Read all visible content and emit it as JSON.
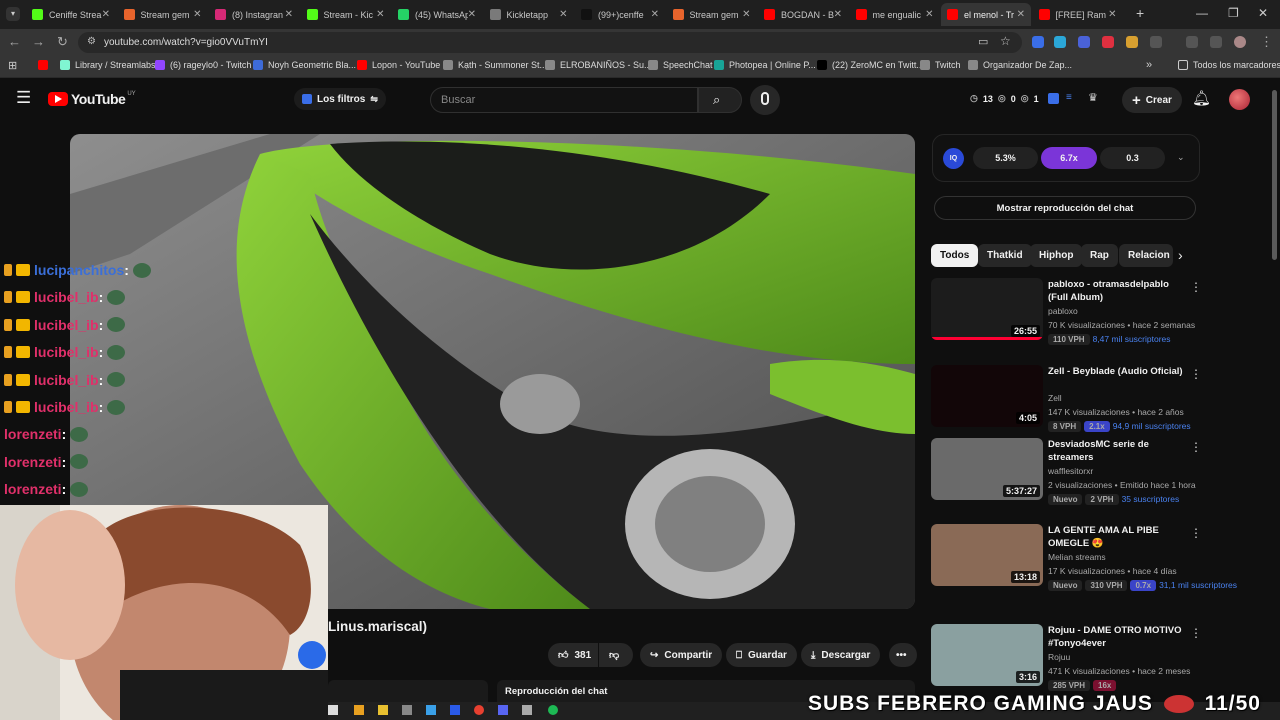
{
  "browser": {
    "tabs": [
      {
        "label": "Ceniffe Strea",
        "color": "#53fc18"
      },
      {
        "label": "Stream gem",
        "color": "#e8642c"
      },
      {
        "label": "(8) Instagran",
        "color": "#d62976"
      },
      {
        "label": "Stream - Kic",
        "color": "#53fc18"
      },
      {
        "label": "(45) WhatsAp",
        "color": "#25d366"
      },
      {
        "label": "Kickletapp",
        "color": "#7a7a7a"
      },
      {
        "label": "(99+)cenffe",
        "color": "#111111"
      },
      {
        "label": "Stream gem",
        "color": "#e8642c"
      },
      {
        "label": "BOGDAN - B",
        "color": "#ff0000"
      },
      {
        "label": "me engualic",
        "color": "#ff0000"
      },
      {
        "label": "el menol - Tr",
        "color": "#ff0000"
      },
      {
        "label": "[FREE] Ram",
        "color": "#ff0000"
      }
    ],
    "url": "youtube.com/watch?v=gio0VVuTmYI",
    "bookmarks": [
      {
        "label": "",
        "color": "#ff0000"
      },
      {
        "label": "Library / Streamlabs",
        "color": "#80f5d2"
      },
      {
        "label": "(6) rageylo0 - Twitch",
        "color": "#9146ff"
      },
      {
        "label": "Noyh Geometric Bla...",
        "color": "#3d6bd8"
      },
      {
        "label": "Lopon - YouTube",
        "color": "#ff0000"
      },
      {
        "label": "Kạth - Summoner St...",
        "color": "#888888"
      },
      {
        "label": "ELROBANIÑOS - Su...",
        "color": "#888888"
      },
      {
        "label": "SpeechChat",
        "color": "#888888"
      },
      {
        "label": "Photopea | Online P...",
        "color": "#18a497"
      },
      {
        "label": "(22) ZeroMC en Twitt...",
        "color": "#000000"
      },
      {
        "label": "Twitch",
        "color": "#888888"
      },
      {
        "label": "Organizador De Zap...",
        "color": "#888888"
      }
    ],
    "all_bookmarks": "Todos los marcadores"
  },
  "youtube": {
    "logo": "YouTube",
    "country": "UY",
    "filter_label": "Los filtros",
    "search_placeholder": "Buscar",
    "header_stats": {
      "a": "13",
      "b": "0",
      "c": "1"
    },
    "create_label": "Crear",
    "ext_stats": {
      "p1": "5.3%",
      "p2": "6.7x",
      "p3": "0.3"
    },
    "show_chat": "Mostrar reproducción del chat",
    "chips": [
      "Todos",
      "Thatkid",
      "Hiphop",
      "Rap",
      "Relacion"
    ],
    "video_title_fragment": "Linus.mariscal)",
    "likes": "381",
    "share": "Compartir",
    "save": "Guardar",
    "download": "Descargar",
    "chat_replay": "Reproducción del chat"
  },
  "chat_overlay": [
    {
      "user": "lucipanchitos",
      "color": "#3b6fd8"
    },
    {
      "user": "lucibel_ib",
      "color": "#e0306a"
    },
    {
      "user": "lucibel_ib",
      "color": "#e0306a"
    },
    {
      "user": "lucibel_ib",
      "color": "#e0306a"
    },
    {
      "user": "lucibel_ib",
      "color": "#e0306a"
    },
    {
      "user": "lucibel_ib",
      "color": "#e0306a"
    },
    {
      "user": "lorenzeti",
      "color": "#e0306a"
    },
    {
      "user": "lorenzeti",
      "color": "#e0306a"
    },
    {
      "user": "lorenzeti",
      "color": "#e0306a"
    }
  ],
  "recommendations": [
    {
      "title": "pabloxo - otramasdelpablo (Full Album)",
      "channel": "pabloxo",
      "meta": "70 K visualizaciones • hace 2 semanas",
      "duration": "26:55",
      "tags": [
        "110 VPH"
      ],
      "subs": "8,47 mil suscriptores",
      "thumb": "#1c1c1c"
    },
    {
      "title": "Zell - Beyblade (Audio Oficial)",
      "channel": "Zell",
      "meta": "147 K visualizaciones • hace 2 años",
      "duration": "4:05",
      "tags": [
        "8 VPH",
        "2.1x"
      ],
      "subs": "94,9 mil suscriptores",
      "thumb": "#120608"
    },
    {
      "title": "DesviadosMC serie de streamers",
      "channel": "wafflesitorxr",
      "meta": "2 visualizaciones • Emitido hace 1 hora",
      "duration": "5:37:27",
      "tags": [
        "Nuevo",
        "2 VPH"
      ],
      "subs": "35 suscriptores",
      "thumb": "#6a6a6a"
    },
    {
      "title": "LA GENTE AMA AL PIBE OMEGLE 😍",
      "channel": "Melian streams",
      "meta": "17 K visualizaciones • hace 4 días",
      "duration": "13:18",
      "tags": [
        "Nuevo",
        "310 VPH",
        "0.7x"
      ],
      "subs": "31,1 mil suscriptores",
      "thumb": "#8a6a56"
    },
    {
      "title": "Rojuu - DAME OTRO MOTIVO #Tonyo4ever",
      "channel": "Rojuu",
      "meta": "471 K visualizaciones • hace 2 meses",
      "duration": "3:16",
      "tags": [
        "285 VPH",
        "16x"
      ],
      "subs": "",
      "thumb": "#8aa0a0"
    }
  ],
  "stream_overlay": {
    "subs_text": "SUBS FEBRERO GAMING JAUS",
    "counter": "11/50"
  }
}
